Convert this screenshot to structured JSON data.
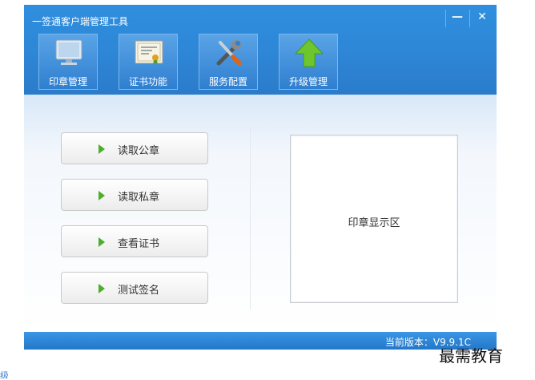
{
  "window": {
    "title": "一签通客户端管理工具",
    "minimize_label": "—",
    "close_label": "✕"
  },
  "toolbar": [
    {
      "label": "印章管理",
      "icon": "monitor-icon"
    },
    {
      "label": "证书功能",
      "icon": "certificate-icon"
    },
    {
      "label": "服务配置",
      "icon": "tools-icon"
    },
    {
      "label": "升级管理",
      "icon": "upgrade-arrow-icon"
    }
  ],
  "actions": [
    {
      "label": "读取公章",
      "icon": "play-arrow-icon"
    },
    {
      "label": "读取私章",
      "icon": "play-arrow-icon"
    },
    {
      "label": "查看证书",
      "icon": "play-arrow-icon"
    },
    {
      "label": "测试签名",
      "icon": "play-arrow-icon"
    }
  ],
  "seal_area": {
    "caption": "印章显示区"
  },
  "status": {
    "version_text": "当前版本：V9.9.1C"
  },
  "watermark": "最需教育",
  "colors": {
    "header_blue": "#2e86d6",
    "play_green": "#4cae2b",
    "upgrade_green": "#6cc62c"
  }
}
